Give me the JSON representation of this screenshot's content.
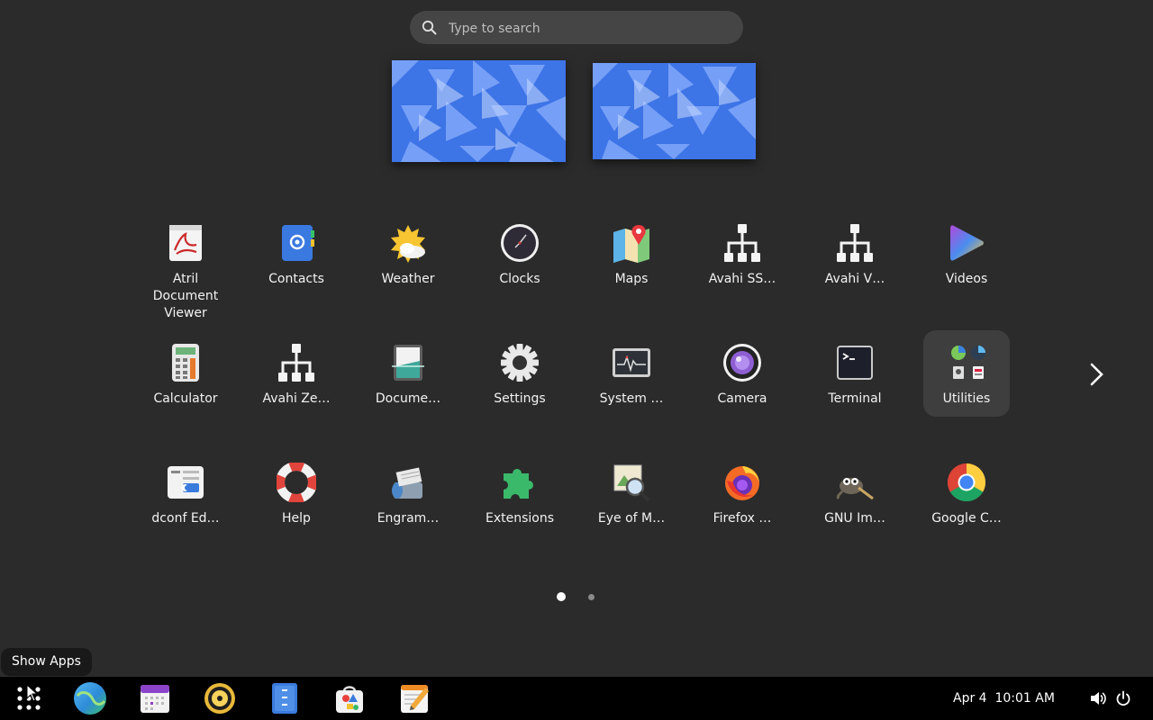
{
  "search": {
    "placeholder": "Type to search",
    "icon": "search-icon"
  },
  "workspaces": [
    {
      "name": "workspace-1"
    },
    {
      "name": "workspace-2"
    }
  ],
  "apps": [
    {
      "label": "Atril Document Viewer",
      "icon": "atril-icon"
    },
    {
      "label": "Contacts",
      "icon": "contacts-icon"
    },
    {
      "label": "Weather",
      "icon": "weather-icon"
    },
    {
      "label": "Clocks",
      "icon": "clocks-icon"
    },
    {
      "label": "Maps",
      "icon": "maps-icon"
    },
    {
      "label": "Avahi SS…",
      "icon": "network-icon"
    },
    {
      "label": "Avahi V…",
      "icon": "network-icon"
    },
    {
      "label": "Videos",
      "icon": "videos-icon"
    },
    {
      "label": "Calculator",
      "icon": "calculator-icon"
    },
    {
      "label": "Avahi Ze…",
      "icon": "network-icon"
    },
    {
      "label": "Docume…",
      "icon": "document-scanner-icon"
    },
    {
      "label": "Settings",
      "icon": "gear-icon"
    },
    {
      "label": "System …",
      "icon": "system-monitor-icon"
    },
    {
      "label": "Camera",
      "icon": "camera-icon"
    },
    {
      "label": "Terminal",
      "icon": "terminal-icon"
    },
    {
      "label": "Utilities",
      "icon": "folder-icon"
    },
    {
      "label": "dconf Ed…",
      "icon": "dconf-icon"
    },
    {
      "label": "Help",
      "icon": "lifebuoy-icon"
    },
    {
      "label": "Engram…",
      "icon": "engrampa-icon"
    },
    {
      "label": "Extensions",
      "icon": "puzzle-icon"
    },
    {
      "label": "Eye of M…",
      "icon": "image-viewer-icon"
    },
    {
      "label": "Firefox …",
      "icon": "firefox-icon"
    },
    {
      "label": "GNU Im…",
      "icon": "gimp-icon"
    },
    {
      "label": "Google C…",
      "icon": "chrome-icon"
    }
  ],
  "pagination": {
    "current_page": 1,
    "total_pages": 2
  },
  "tooltip": "Show Apps",
  "taskbar": {
    "items": [
      "show-apps-icon",
      "browser-icon",
      "calendar-icon",
      "music-player-icon",
      "files-icon",
      "software-store-icon",
      "text-editor-icon"
    ],
    "date": "Apr 4",
    "time": "10:01 AM",
    "tray": [
      "volume-icon",
      "power-icon"
    ]
  },
  "colors": {
    "background": "#2b2b2b",
    "panel": "#000000",
    "search_bg": "#454545",
    "highlight": "#3e3e3e"
  }
}
